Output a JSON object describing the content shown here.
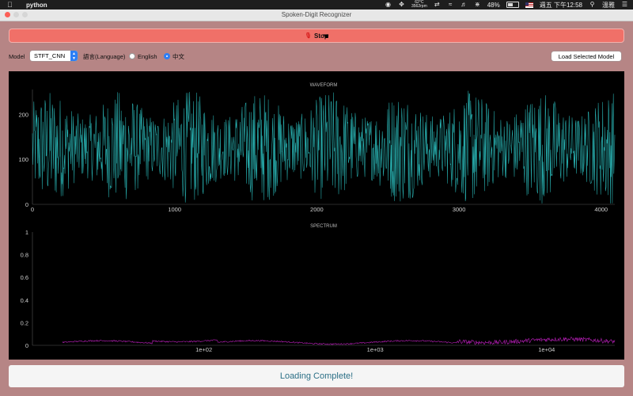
{
  "menubar": {
    "app_name": "python",
    "temp_line1": "62°C",
    "temp_line2": "3562rpm",
    "battery": "48%",
    "datetime": "週五 下午12:58",
    "user": "溫雅"
  },
  "window": {
    "title": "Spoken-Digit Recognizer"
  },
  "stop_button": {
    "label": "Stop"
  },
  "controls": {
    "model_label": "Model",
    "model_value": "STFT_CNN",
    "language_label": "語言(Language)",
    "english_label": "English",
    "chinese_label": "中文",
    "selected_language": "中文",
    "load_button": "Load Selected Model"
  },
  "status": {
    "text": "Loading Complete!"
  },
  "colors": {
    "waveform": "#2ab8b8",
    "spectrum": "#c020c0",
    "stop": "#f07068"
  },
  "chart_data": [
    {
      "type": "line",
      "title": "WAVEFORM",
      "xlim": [
        0,
        4096
      ],
      "ylim": [
        0,
        255
      ],
      "xticks": [
        0,
        1000,
        2000,
        3000,
        4000
      ],
      "yticks": [
        0,
        100,
        200
      ],
      "xtick_labels": [
        "0",
        "1000",
        "2000",
        "3000",
        "4000"
      ],
      "ytick_labels": [
        "0",
        "100",
        "200"
      ],
      "series": [
        {
          "values": []
        }
      ]
    },
    {
      "type": "line",
      "title": "SPECTRUM",
      "xscale": "log",
      "xlim": [
        10,
        25000
      ],
      "ylim": [
        0,
        1
      ],
      "xticks": [
        100,
        1000,
        10000
      ],
      "yticks": [
        0,
        0.2,
        0.4,
        0.6,
        0.8,
        1
      ],
      "xtick_labels": [
        "1e+02",
        "1e+03",
        "1e+04"
      ],
      "ytick_labels": [
        "0",
        "0.2",
        "0.4",
        "0.6",
        "0.8",
        "1"
      ],
      "series": [
        {
          "values": []
        }
      ]
    }
  ]
}
